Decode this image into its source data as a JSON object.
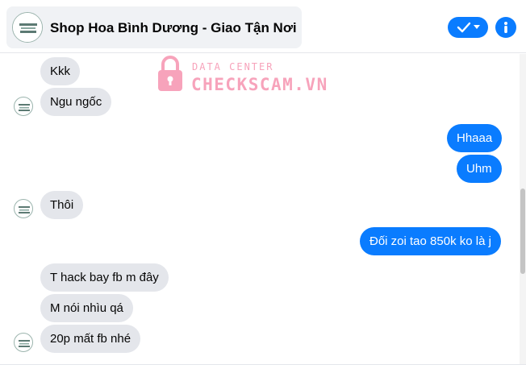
{
  "header": {
    "contact_name": "Shop Hoa Bình Dương - Giao Tận Nơi",
    "avatar_icon": "flower-shop-logo-icon",
    "action_icon": "check-dropdown-icon",
    "info_icon": "info-icon",
    "accent_color": "#0a7cff"
  },
  "watermark": {
    "top_text": "DATA CENTER",
    "main_text": "CHECKSCAM.VN",
    "icon": "lock-icon",
    "color": "#f7a3bb"
  },
  "messages": [
    {
      "side": "in",
      "text": "Kkk"
    },
    {
      "side": "in",
      "text": "Ngu ngốc"
    },
    {
      "side": "out",
      "text": "Hhaaa"
    },
    {
      "side": "out",
      "text": "Uhm"
    },
    {
      "side": "in",
      "text": "Thôi"
    },
    {
      "side": "out",
      "text": "Đối zoi tao 850k ko là j"
    },
    {
      "side": "in",
      "text": "T hack bay fb m đây"
    },
    {
      "side": "in",
      "text": "M nói nhìu qá"
    },
    {
      "side": "in",
      "text": "20p mất fb nhé"
    }
  ]
}
